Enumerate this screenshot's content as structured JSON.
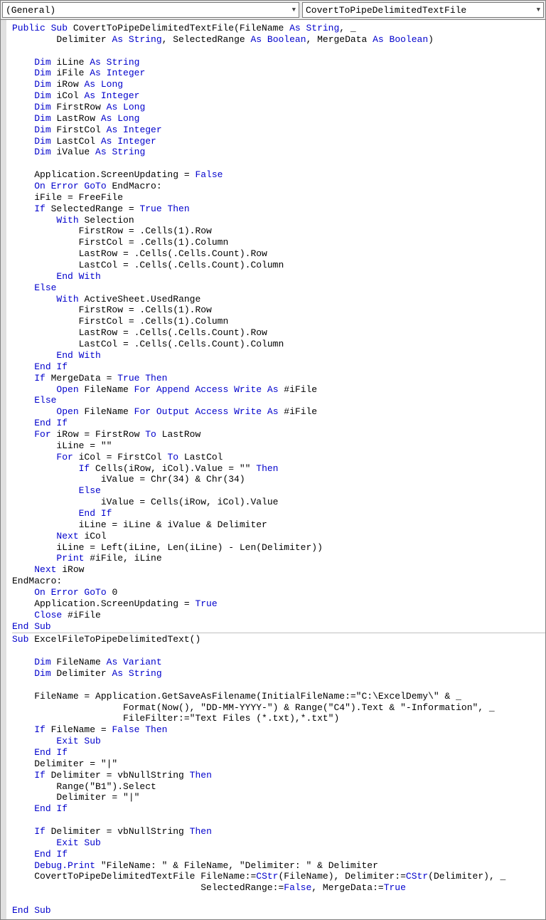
{
  "dropdowns": {
    "left": "(General)",
    "right": "CovertToPipeDelimitedTextFile"
  },
  "code": [
    [
      [
        "kw",
        "Public Sub"
      ],
      [
        "",
        " CovertToPipeDelimitedTextFile(FileName "
      ],
      [
        "kw",
        "As String"
      ],
      [
        "",
        ", _"
      ]
    ],
    [
      [
        "",
        "        Delimiter "
      ],
      [
        "kw",
        "As String"
      ],
      [
        "",
        ", SelectedRange "
      ],
      [
        "kw",
        "As Boolean"
      ],
      [
        "",
        ", MergeData "
      ],
      [
        "kw",
        "As Boolean"
      ],
      [
        "",
        ")"
      ]
    ],
    [],
    [
      [
        "",
        "    "
      ],
      [
        "kw",
        "Dim"
      ],
      [
        "",
        " iLine "
      ],
      [
        "kw",
        "As String"
      ]
    ],
    [
      [
        "",
        "    "
      ],
      [
        "kw",
        "Dim"
      ],
      [
        "",
        " iFile "
      ],
      [
        "kw",
        "As Integer"
      ]
    ],
    [
      [
        "",
        "    "
      ],
      [
        "kw",
        "Dim"
      ],
      [
        "",
        " iRow "
      ],
      [
        "kw",
        "As Long"
      ]
    ],
    [
      [
        "",
        "    "
      ],
      [
        "kw",
        "Dim"
      ],
      [
        "",
        " iCol "
      ],
      [
        "kw",
        "As Integer"
      ]
    ],
    [
      [
        "",
        "    "
      ],
      [
        "kw",
        "Dim"
      ],
      [
        "",
        " FirstRow "
      ],
      [
        "kw",
        "As Long"
      ]
    ],
    [
      [
        "",
        "    "
      ],
      [
        "kw",
        "Dim"
      ],
      [
        "",
        " LastRow "
      ],
      [
        "kw",
        "As Long"
      ]
    ],
    [
      [
        "",
        "    "
      ],
      [
        "kw",
        "Dim"
      ],
      [
        "",
        " FirstCol "
      ],
      [
        "kw",
        "As Integer"
      ]
    ],
    [
      [
        "",
        "    "
      ],
      [
        "kw",
        "Dim"
      ],
      [
        "",
        " LastCol "
      ],
      [
        "kw",
        "As Integer"
      ]
    ],
    [
      [
        "",
        "    "
      ],
      [
        "kw",
        "Dim"
      ],
      [
        "",
        " iValue "
      ],
      [
        "kw",
        "As String"
      ]
    ],
    [],
    [
      [
        "",
        "    Application.ScreenUpdating = "
      ],
      [
        "kw",
        "False"
      ]
    ],
    [
      [
        "",
        "    "
      ],
      [
        "kw",
        "On Error GoTo"
      ],
      [
        "",
        " EndMacro:"
      ]
    ],
    [
      [
        "",
        "    iFile = FreeFile"
      ]
    ],
    [
      [
        "",
        "    "
      ],
      [
        "kw",
        "If"
      ],
      [
        "",
        " SelectedRange = "
      ],
      [
        "kw",
        "True Then"
      ]
    ],
    [
      [
        "",
        "        "
      ],
      [
        "kw",
        "With"
      ],
      [
        "",
        " Selection"
      ]
    ],
    [
      [
        "",
        "            FirstRow = .Cells(1).Row"
      ]
    ],
    [
      [
        "",
        "            FirstCol = .Cells(1).Column"
      ]
    ],
    [
      [
        "",
        "            LastRow = .Cells(.Cells.Count).Row"
      ]
    ],
    [
      [
        "",
        "            LastCol = .Cells(.Cells.Count).Column"
      ]
    ],
    [
      [
        "",
        "        "
      ],
      [
        "kw",
        "End With"
      ]
    ],
    [
      [
        "",
        "    "
      ],
      [
        "kw",
        "Else"
      ]
    ],
    [
      [
        "",
        "        "
      ],
      [
        "kw",
        "With"
      ],
      [
        "",
        " ActiveSheet.UsedRange"
      ]
    ],
    [
      [
        "",
        "            FirstRow = .Cells(1).Row"
      ]
    ],
    [
      [
        "",
        "            FirstCol = .Cells(1).Column"
      ]
    ],
    [
      [
        "",
        "            LastRow = .Cells(.Cells.Count).Row"
      ]
    ],
    [
      [
        "",
        "            LastCol = .Cells(.Cells.Count).Column"
      ]
    ],
    [
      [
        "",
        "        "
      ],
      [
        "kw",
        "End With"
      ]
    ],
    [
      [
        "",
        "    "
      ],
      [
        "kw",
        "End If"
      ]
    ],
    [
      [
        "",
        "    "
      ],
      [
        "kw",
        "If"
      ],
      [
        "",
        " MergeData = "
      ],
      [
        "kw",
        "True Then"
      ]
    ],
    [
      [
        "",
        "        "
      ],
      [
        "kw",
        "Open"
      ],
      [
        "",
        " FileName "
      ],
      [
        "kw",
        "For Append Access Write As"
      ],
      [
        "",
        " #iFile"
      ]
    ],
    [
      [
        "",
        "    "
      ],
      [
        "kw",
        "Else"
      ]
    ],
    [
      [
        "",
        "        "
      ],
      [
        "kw",
        "Open"
      ],
      [
        "",
        " FileName "
      ],
      [
        "kw",
        "For Output Access Write As"
      ],
      [
        "",
        " #iFile"
      ]
    ],
    [
      [
        "",
        "    "
      ],
      [
        "kw",
        "End If"
      ]
    ],
    [
      [
        "",
        "    "
      ],
      [
        "kw",
        "For"
      ],
      [
        "",
        " iRow = FirstRow "
      ],
      [
        "kw",
        "To"
      ],
      [
        "",
        " LastRow"
      ]
    ],
    [
      [
        "",
        "        iLine = \"\""
      ]
    ],
    [
      [
        "",
        "        "
      ],
      [
        "kw",
        "For"
      ],
      [
        "",
        " iCol = FirstCol "
      ],
      [
        "kw",
        "To"
      ],
      [
        "",
        " LastCol"
      ]
    ],
    [
      [
        "",
        "            "
      ],
      [
        "kw",
        "If"
      ],
      [
        "",
        " Cells(iRow, iCol).Value = \"\" "
      ],
      [
        "kw",
        "Then"
      ]
    ],
    [
      [
        "",
        "                iValue = Chr(34) & Chr(34)"
      ]
    ],
    [
      [
        "",
        "            "
      ],
      [
        "kw",
        "Else"
      ]
    ],
    [
      [
        "",
        "                iValue = Cells(iRow, iCol).Value"
      ]
    ],
    [
      [
        "",
        "            "
      ],
      [
        "kw",
        "End If"
      ]
    ],
    [
      [
        "",
        "            iLine = iLine & iValue & Delimiter"
      ]
    ],
    [
      [
        "",
        "        "
      ],
      [
        "kw",
        "Next"
      ],
      [
        "",
        " iCol"
      ]
    ],
    [
      [
        "",
        "        iLine = Left(iLine, Len(iLine) - Len(Delimiter))"
      ]
    ],
    [
      [
        "",
        "        "
      ],
      [
        "kw",
        "Print"
      ],
      [
        "",
        " #iFile, iLine"
      ]
    ],
    [
      [
        "",
        "    "
      ],
      [
        "kw",
        "Next"
      ],
      [
        "",
        " iRow"
      ]
    ],
    [
      [
        "",
        "EndMacro:"
      ]
    ],
    [
      [
        "",
        "    "
      ],
      [
        "kw",
        "On Error GoTo"
      ],
      [
        "",
        " 0"
      ]
    ],
    [
      [
        "",
        "    Application.ScreenUpdating = "
      ],
      [
        "kw",
        "True"
      ]
    ],
    [
      [
        "",
        "    "
      ],
      [
        "kw",
        "Close"
      ],
      [
        "",
        " #iFile"
      ]
    ],
    [
      [
        "kw",
        "End Sub"
      ]
    ],
    "HR",
    [
      [
        "kw",
        "Sub"
      ],
      [
        "",
        " ExcelFileToPipeDelimitedText()"
      ]
    ],
    [],
    [
      [
        "",
        "    "
      ],
      [
        "kw",
        "Dim"
      ],
      [
        "",
        " FileName "
      ],
      [
        "kw",
        "As Variant"
      ]
    ],
    [
      [
        "",
        "    "
      ],
      [
        "kw",
        "Dim"
      ],
      [
        "",
        " Delimiter "
      ],
      [
        "kw",
        "As String"
      ]
    ],
    [],
    [
      [
        "",
        "    FileName = Application.GetSaveAsFilename(InitialFileName:=\"C:\\ExcelDemy\\\" & _"
      ]
    ],
    [
      [
        "",
        "                    Format(Now(), \"DD-MM-YYYY-\") & Range(\"C4\").Text & \"-Information\", _"
      ]
    ],
    [
      [
        "",
        "                    FileFilter:=\"Text Files (*.txt),*.txt\")"
      ]
    ],
    [
      [
        "",
        "    "
      ],
      [
        "kw",
        "If"
      ],
      [
        "",
        " FileName = "
      ],
      [
        "kw",
        "False Then"
      ]
    ],
    [
      [
        "",
        "        "
      ],
      [
        "kw",
        "Exit Sub"
      ]
    ],
    [
      [
        "",
        "    "
      ],
      [
        "kw",
        "End If"
      ]
    ],
    [
      [
        "",
        "    Delimiter = \"|\""
      ]
    ],
    [
      [
        "",
        "    "
      ],
      [
        "kw",
        "If"
      ],
      [
        "",
        " Delimiter = vbNullString "
      ],
      [
        "kw",
        "Then"
      ]
    ],
    [
      [
        "",
        "        Range(\"B1\").Select"
      ]
    ],
    [
      [
        "",
        "        Delimiter = \"|\""
      ]
    ],
    [
      [
        "",
        "    "
      ],
      [
        "kw",
        "End If"
      ]
    ],
    [],
    [
      [
        "",
        "    "
      ],
      [
        "kw",
        "If"
      ],
      [
        "",
        " Delimiter = vbNullString "
      ],
      [
        "kw",
        "Then"
      ]
    ],
    [
      [
        "",
        "        "
      ],
      [
        "kw",
        "Exit Sub"
      ]
    ],
    [
      [
        "",
        "    "
      ],
      [
        "kw",
        "End If"
      ]
    ],
    [
      [
        "",
        "    "
      ],
      [
        "kw",
        "Debug.Print"
      ],
      [
        "",
        " \"FileName: \" & FileName, \"Delimiter: \" & Delimiter"
      ]
    ],
    [
      [
        "",
        "    CovertToPipeDelimitedTextFile FileName:="
      ],
      [
        "kw",
        "CStr"
      ],
      [
        "",
        "(FileName), Delimiter:="
      ],
      [
        "kw",
        "CStr"
      ],
      [
        "",
        "(Delimiter), _"
      ]
    ],
    [
      [
        "",
        "                                  SelectedRange:="
      ],
      [
        "kw",
        "False"
      ],
      [
        "",
        ", MergeData:="
      ],
      [
        "kw",
        "True"
      ]
    ],
    [],
    [
      [
        "kw",
        "End Sub"
      ]
    ]
  ]
}
